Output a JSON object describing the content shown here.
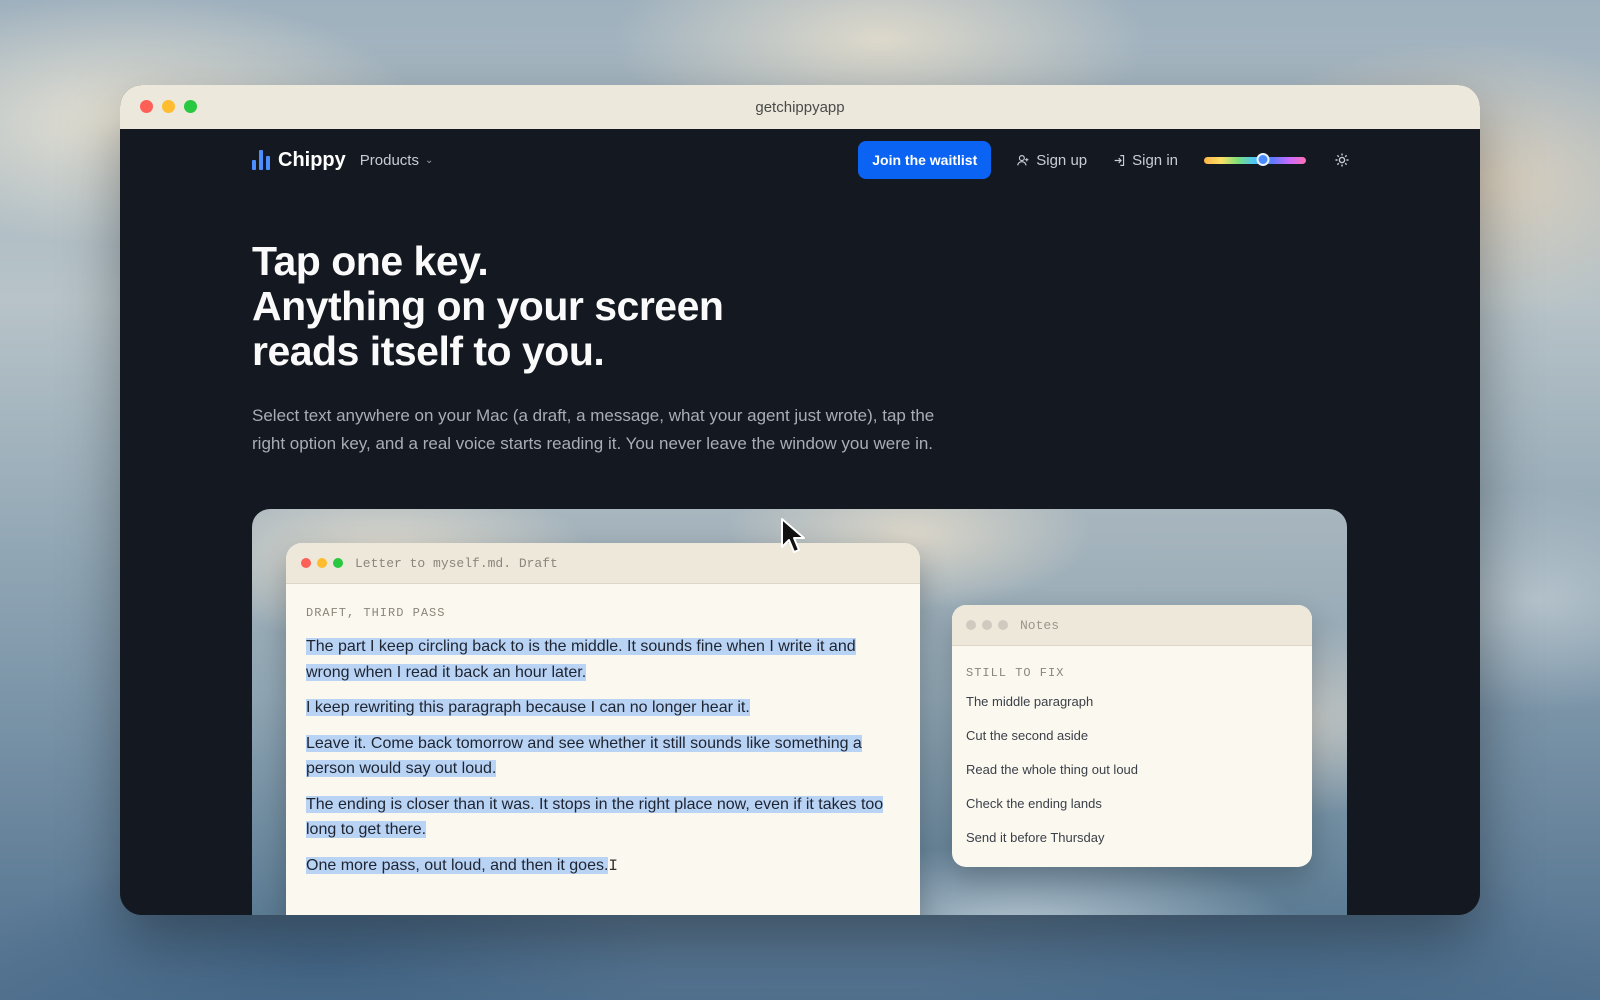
{
  "browser": {
    "url": "getchippyapp"
  },
  "nav": {
    "brand": "Chippy",
    "products_label": "Products",
    "cta_label": "Join the waitlist",
    "signup_label": "Sign up",
    "signin_label": "Sign in",
    "hue_slider_value": 0.58
  },
  "hero": {
    "line1": "Tap one key.",
    "line2": "Anything on your screen",
    "line3": "reads itself to you.",
    "subtitle": "Select text anywhere on your Mac (a draft, a message, what your agent just wrote), tap the right option key, and a real voice starts reading it. You never leave the window you were in."
  },
  "editor": {
    "title": "Letter to myself.md. Draft",
    "eyebrow": "DRAFT, THIRD PASS",
    "paragraphs": [
      "The part I keep circling back to is the middle. It sounds fine when I write it and wrong when I read it back an hour later.",
      "I keep rewriting this paragraph because I can no longer hear it.",
      "Leave it. Come back tomorrow and see whether it still sounds like something a person would say out loud.",
      "The ending is closer than it was. It stops in the right place now, even if it takes too long to get there.",
      "One more pass, out loud, and then it goes."
    ]
  },
  "notes": {
    "title": "Notes",
    "eyebrow": "STILL TO FIX",
    "items": [
      "The middle paragraph",
      "Cut the second aside",
      "Read the whole thing out loud",
      "Check the ending lands",
      "Send it before Thursday"
    ]
  },
  "colors": {
    "accent": "#0a63f2",
    "page_bg": "#141820",
    "selection": "#b9d3f5"
  }
}
